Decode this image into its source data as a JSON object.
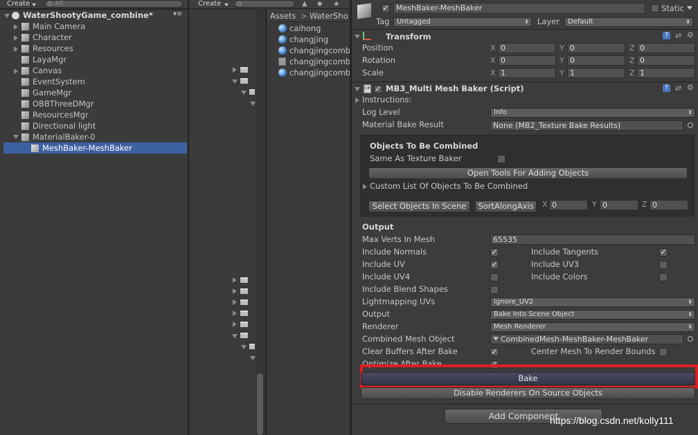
{
  "hierarchy": {
    "create": "Create",
    "search_placeholder": "All",
    "scene": "WaterShootyGame_combine*",
    "items": [
      {
        "label": "Main Camera"
      },
      {
        "label": "Character"
      },
      {
        "label": "Resources"
      },
      {
        "label": "LayaMgr"
      },
      {
        "label": "Canvas"
      },
      {
        "label": "EventSystem"
      },
      {
        "label": "GameMgr"
      },
      {
        "label": "OBBThreeDMgr"
      },
      {
        "label": "ResourcesMgr"
      },
      {
        "label": "Directional light"
      },
      {
        "label": "MaterialBaker-0"
      },
      {
        "label": "MeshBaker-MeshBaker"
      }
    ]
  },
  "project": {
    "create": "Create",
    "breadcrumb_root": "Assets",
    "breadcrumb_sep": ">",
    "breadcrumb_folder": "WaterSho",
    "files": [
      {
        "label": "caihong"
      },
      {
        "label": "changjing"
      },
      {
        "label": "changjingcomb"
      },
      {
        "label": "changjingcomb"
      },
      {
        "label": "changjingcomb"
      }
    ]
  },
  "inspector": {
    "object_name": "MeshBaker-MeshBaker",
    "static_label": "Static",
    "tag_label": "Tag",
    "tag_value": "Untagged",
    "layer_label": "Layer",
    "layer_value": "Default",
    "transform": {
      "title": "Transform",
      "rows": [
        {
          "label": "Position",
          "x": "0",
          "y": "0",
          "z": "0"
        },
        {
          "label": "Rotation",
          "x": "0",
          "y": "0",
          "z": "0"
        },
        {
          "label": "Scale",
          "x": "1",
          "y": "1",
          "z": "1"
        }
      ],
      "axis_x": "X",
      "axis_y": "Y",
      "axis_z": "Z"
    },
    "script": {
      "title": "MB3_Multi Mesh Baker (Script)",
      "instructions": "Instructions:",
      "log_level_label": "Log Level",
      "log_level_value": "Info",
      "material_bake_label": "Material Bake Result",
      "material_bake_value": "None (MB2_Texture Bake Results)"
    },
    "objects_box": {
      "title": "Objects To Be Combined",
      "same_as_label": "Same As Texture Baker",
      "open_tools_button": "Open Tools For Adding Objects",
      "custom_list": "Custom List Of Objects To Be Combined",
      "select_button": "Select Objects In Scene",
      "sort_button": "SortAlongAxis",
      "sort_x": "0",
      "sort_y": "0",
      "sort_z": "0"
    },
    "output": {
      "title": "Output",
      "max_verts_label": "Max Verts In Mesh",
      "max_verts_value": "65535",
      "include_normals": "Include Normals",
      "include_tangents": "Include Tangents",
      "include_uv": "Include UV",
      "include_uv3": "Include UV3",
      "include_uv4": "Include UV4",
      "include_colors": "Include Colors",
      "include_blend": "Include Blend Shapes",
      "lightmapping_label": "Lightmapping UVs",
      "lightmapping_value": "Ignore_UV2",
      "output_label": "Output",
      "output_value": "Bake Into Scene Object",
      "renderer_label": "Renderer",
      "renderer_value": "Mesh Renderer",
      "combined_label": "Combined Mesh Object",
      "combined_value": "CombinedMesh-MeshBaker-MeshBaker",
      "clear_buffers": "Clear Buffers After Bake",
      "center_mesh": "Center Mesh To Render Bounds",
      "optimize": "Optimize After Bake",
      "bake_button": "Bake",
      "disable_renderers_button": "Disable Renderers On Source Objects",
      "add_component_button": "Add Component"
    },
    "check_mark": "✓"
  },
  "watermark": "https://blog.csdn.net/kolly111",
  "colors": {
    "highlight": "#e01c24",
    "selected": "#3d60a0"
  }
}
